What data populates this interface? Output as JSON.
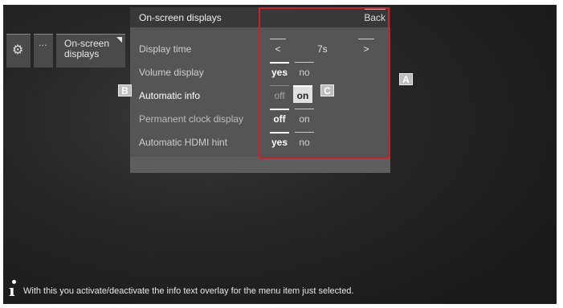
{
  "window": {
    "background": "#1f1f1f",
    "accent": "#cc1f2f"
  },
  "breadcrumb": {
    "items": [
      {
        "icon": "gear-icon",
        "glyph": "⚙"
      },
      {
        "label": "···"
      },
      {
        "label": "On-screen displays",
        "icon": "corner-triangle-icon"
      }
    ]
  },
  "panel": {
    "title": "On-screen displays",
    "back_label": "Back",
    "rows": [
      {
        "label": "Display time",
        "prev": "<",
        "value": "7s",
        "next": ">"
      },
      {
        "label": "Volume display",
        "options": [
          "yes",
          "no"
        ],
        "selected": "yes"
      },
      {
        "label": "Automatic info",
        "options": [
          "off",
          "on"
        ],
        "selected": "on",
        "focused": true
      },
      {
        "label": "Permanent clock display",
        "options": [
          "off",
          "on"
        ],
        "selected": "off"
      },
      {
        "label": "Automatic HDMI hint",
        "options": [
          "yes",
          "no"
        ],
        "selected": "yes"
      }
    ]
  },
  "markers": {
    "a": "A",
    "b": "B",
    "c": "C"
  },
  "info": {
    "icon": "info-icon",
    "text": "With this you activate/deactivate the info text overlay for the menu item just selected."
  }
}
